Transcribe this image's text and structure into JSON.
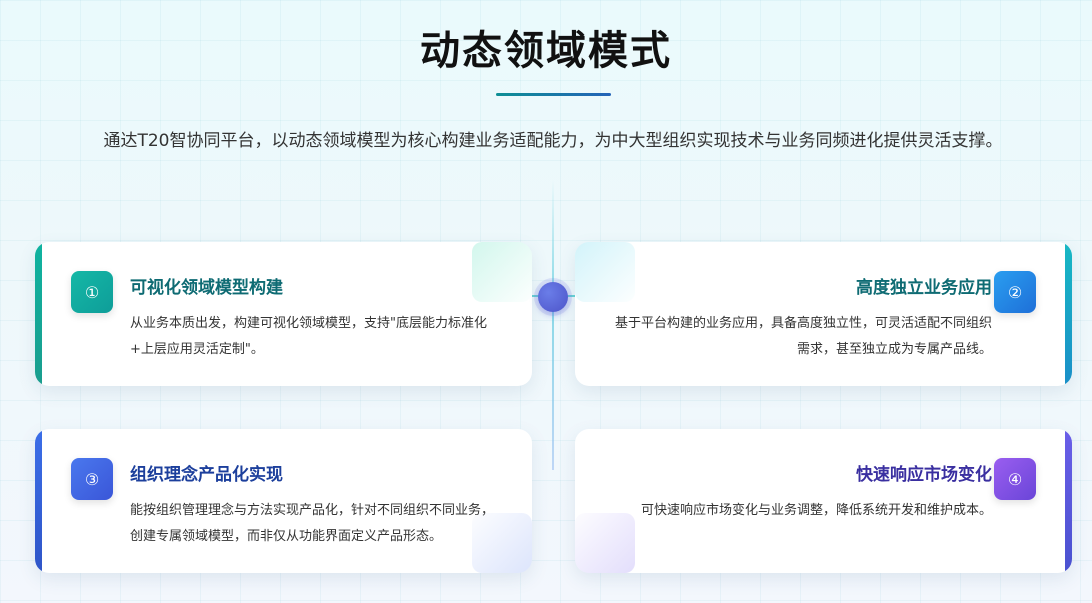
{
  "page": {
    "title": "动态领域模式",
    "subtitle": "通达T20智协同平台，以动态领域模型为核心构建业务适配能力，为中大型组织实现技术与业务同频进化提供灵活支撑。"
  },
  "cards": [
    {
      "badge": "①",
      "title": "可视化领域模型构建",
      "desc": "从业务本质出发，构建可视化领域模型，支持\"底层能力标准化+上层应用灵活定制\"。",
      "color": "#0fa69a"
    },
    {
      "badge": "②",
      "title": "高度独立业务应用",
      "desc": "基于平台构建的业务应用，具备高度独立性，可灵活适配不同组织需求，甚至独立成为专属产品线。",
      "color": "#1e8ae6"
    },
    {
      "badge": "③",
      "title": "组织理念产品化实现",
      "desc": "能按组织管理理念与方法实现产品化，针对不同组织不同业务，创建专属领域模型，而非仅从功能界面定义产品形态。",
      "color": "#3a66e0"
    },
    {
      "badge": "④",
      "title": "快速响应市场变化",
      "desc": "可快速响应市场变化与业务调整，降低系统开发和维护成本。",
      "color": "#7a4fe0"
    }
  ],
  "colors": {
    "title_teal": "#0e6b73",
    "title_blue": "#1c3f9c",
    "title_purple": "#3a2fa0"
  }
}
